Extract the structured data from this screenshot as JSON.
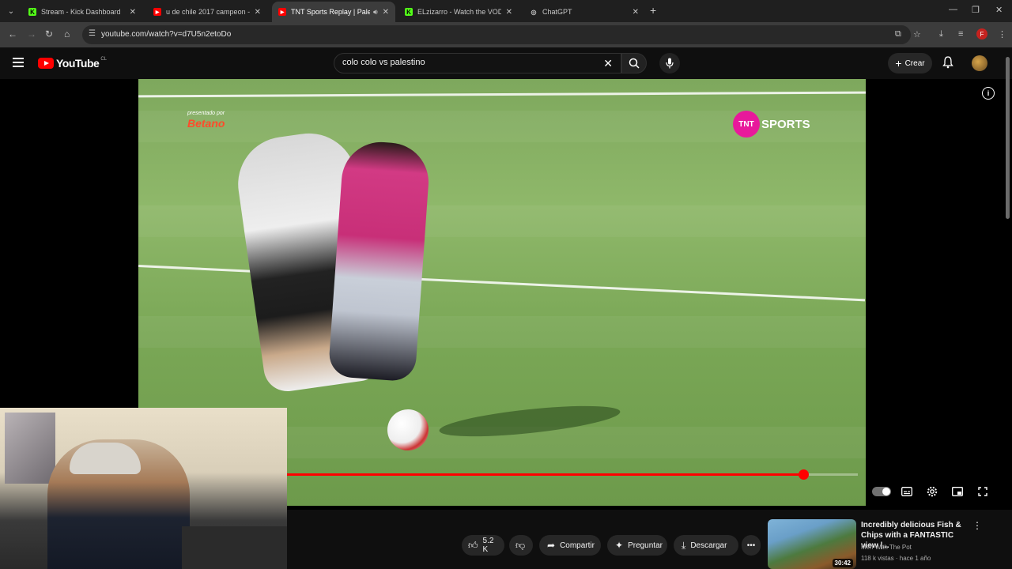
{
  "browser": {
    "tabs": [
      {
        "title": "Stream - Kick Dashboard",
        "favicon_color": "#53fc18",
        "favicon_letter": "K"
      },
      {
        "title": "u de chile 2017 campeon - You",
        "favicon_color": "#ff0000",
        "favicon_letter": "▶"
      },
      {
        "title": "TNT Sports Replay | Palesti",
        "favicon_color": "#ff0000",
        "favicon_letter": "▶",
        "active": true,
        "audio": true
      },
      {
        "title": "ELzizarro - Watch the VOD on",
        "favicon_color": "#53fc18",
        "favicon_letter": "K"
      },
      {
        "title": "ChatGPT",
        "favicon_color": "#9b9b9b",
        "favicon_letter": "◎"
      }
    ],
    "url": "youtube.com/watch?v=d7U5n2etoDo",
    "profile_letter": "F"
  },
  "youtube": {
    "logo_text": "YouTube",
    "country_code": "CL",
    "search_value": "colo colo vs palestino",
    "create_label": "Crear"
  },
  "video": {
    "sponsor_small": "presentado por",
    "sponsor_brand": "Betano",
    "broadcaster_dot": "TNT",
    "broadcaster": "SPORTS",
    "progress_fraction": 0.905,
    "autoplay": true
  },
  "actions": {
    "likes": "5.2 K",
    "share": "Compartir",
    "ask": "Preguntar",
    "download": "Descargar"
  },
  "recommendation": {
    "title": "Incredibly delicious Fish & Chips with a FANTASTIC view |...",
    "channel": "Men With The Pot",
    "meta": "118 k vistas · hace 1 año",
    "duration": "30:42"
  },
  "colors": {
    "accent": "#ff0000",
    "tnt_pink": "#e8199b",
    "background": "#0f0f0f"
  }
}
